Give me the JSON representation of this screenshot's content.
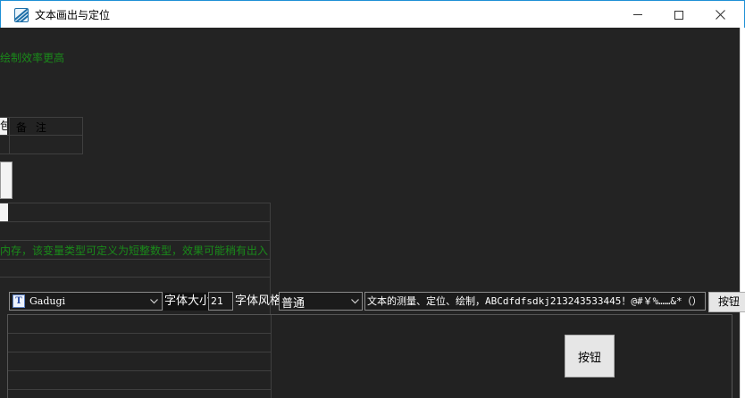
{
  "window": {
    "title": "文本画出与定位",
    "icon": "app-icon"
  },
  "canvas": {
    "text_line_1": "绘制效率更高",
    "text_line_2": "内存，该变量类型可定义为短整数型，效果可能稍有出入",
    "table_header_wall": "包",
    "table_header_remark": "备 注"
  },
  "toolbar": {
    "font_select_value": "Gadugi",
    "font_size_label": "字体大小",
    "font_size_value": "21",
    "font_style_label": "字体风格",
    "font_style_value": "普通",
    "text_input_value": "文本的测量、定位、绘制，ABCdfdfsdkj213243533445！@#￥%……&*（）",
    "button_label": "按钮"
  },
  "panel": {
    "button_label": "按钮"
  },
  "colors": {
    "client_bg": "#232323",
    "green_text": "#1a8a1a",
    "title_border": "#1e90d6"
  }
}
